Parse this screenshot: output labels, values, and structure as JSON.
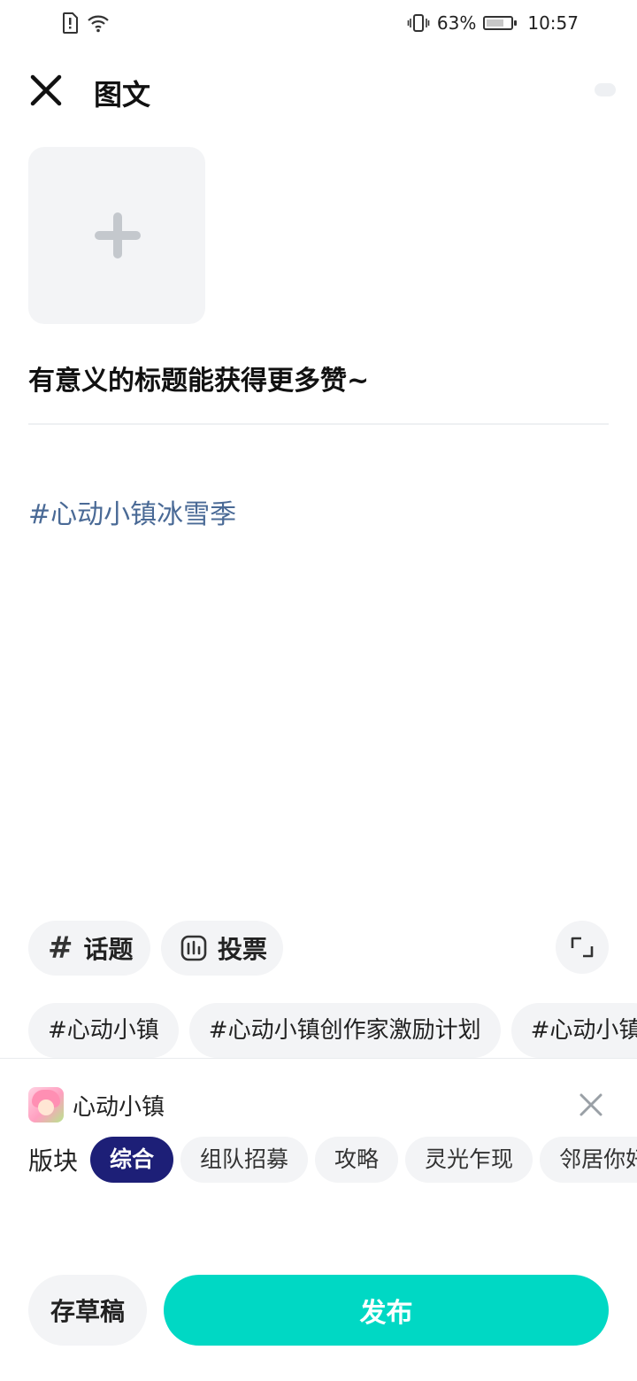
{
  "status_bar": {
    "battery_percent": "63%",
    "time": "10:57",
    "icons": [
      "alert-sim-icon",
      "wifi-icon",
      "vibrate-icon",
      "battery-icon"
    ]
  },
  "header": {
    "title": "图文",
    "close_icon": "close-icon"
  },
  "editor": {
    "add_image_icon": "plus-icon",
    "title_placeholder": "有意义的标题能获得更多赞~",
    "body_text": "#心动小镇冰雪季",
    "body_text_color": "#4a6a96"
  },
  "tools": {
    "topic_label": "话题",
    "vote_label": "投票",
    "expand_icon": "expand-icon"
  },
  "suggested_tags": [
    "#心动小镇",
    "#心动小镇创作家激励计划",
    "#心动小镇"
  ],
  "community": {
    "name": "心动小镇",
    "board_label": "版块",
    "boards": [
      {
        "label": "综合",
        "active": true
      },
      {
        "label": "组队招募",
        "active": false
      },
      {
        "label": "攻略",
        "active": false
      },
      {
        "label": "灵光乍现",
        "active": false
      },
      {
        "label": "邻居你好",
        "active": false
      },
      {
        "label": "",
        "active": false
      }
    ]
  },
  "actions": {
    "draft_label": "存草稿",
    "publish_label": "发布"
  },
  "colors": {
    "accent": "#00d8c4",
    "active_board": "#1d1f77",
    "chip_bg": "#f3f4f6"
  }
}
